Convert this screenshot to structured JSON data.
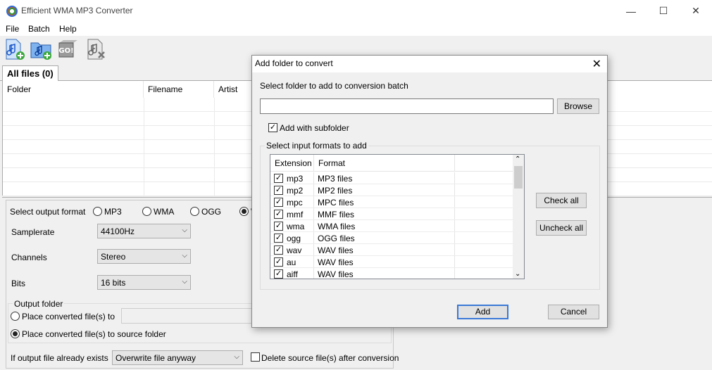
{
  "window": {
    "title": "Efficient WMA MP3 Converter",
    "minimize": "—",
    "maximize": "☐",
    "close": "✕"
  },
  "menu": [
    "File",
    "Batch",
    "Help"
  ],
  "toolbar": {
    "go_label": "GO!"
  },
  "tab": {
    "label": "All files (0)"
  },
  "file_list": {
    "columns": [
      "Folder",
      "Filename",
      "Artist"
    ]
  },
  "options": {
    "output_format_label": "Select output format",
    "formats": [
      "MP3",
      "WMA",
      "OGG",
      "W"
    ],
    "selected_format": "W",
    "samplerate_label": "Samplerate",
    "samplerate_value": "44100Hz",
    "channels_label": "Channels",
    "channels_value": "Stereo",
    "bits_label": "Bits",
    "bits_value": "16 bits",
    "output_folder_label": "Output folder",
    "place_converted_to": "Place converted file(s) to",
    "place_converted_source": "Place converted file(s) to source folder",
    "exists_label": "If output file already exists",
    "exists_value": "Overwrite file anyway",
    "delete_source_label": "Delete source file(s) after conversion"
  },
  "dialog": {
    "title": "Add folder to convert",
    "close": "✕",
    "select_folder_label": "Select folder to add to conversion batch",
    "folder_value": "",
    "browse": "Browse",
    "add_subfolder": "Add with subfolder",
    "input_formats_group": "Select input formats to add",
    "columns": [
      "Extension",
      "Format"
    ],
    "formats": [
      {
        "ext": "mp3",
        "format": "MP3 files",
        "checked": true
      },
      {
        "ext": "mp2",
        "format": "MP2 files",
        "checked": true
      },
      {
        "ext": "mpc",
        "format": "MPC files",
        "checked": true
      },
      {
        "ext": "mmf",
        "format": "MMF files",
        "checked": true
      },
      {
        "ext": "wma",
        "format": "WMA files",
        "checked": true
      },
      {
        "ext": "ogg",
        "format": "OGG files",
        "checked": true
      },
      {
        "ext": "wav",
        "format": "WAV files",
        "checked": true
      },
      {
        "ext": "au",
        "format": "WAV files",
        "checked": true
      },
      {
        "ext": "aiff",
        "format": "WAV files",
        "checked": true
      }
    ],
    "check_all": "Check all",
    "uncheck_all": "Uncheck all",
    "add": "Add",
    "cancel": "Cancel"
  }
}
